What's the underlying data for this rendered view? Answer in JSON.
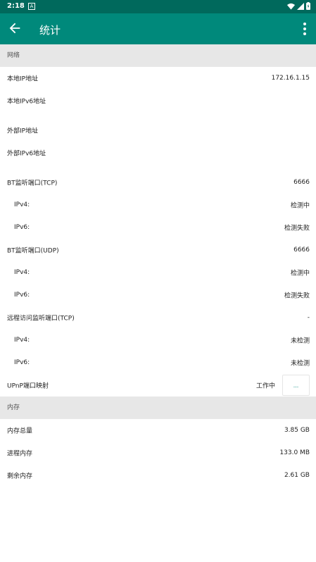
{
  "status_bar": {
    "time": "2:18",
    "notification_letter": "A"
  },
  "app_bar": {
    "title": "统计"
  },
  "network": {
    "header": "网络",
    "local_ipv4": {
      "label": "本地IP地址",
      "value": "172.16.1.15"
    },
    "local_ipv6": {
      "label": "本地IPv6地址",
      "value": ""
    },
    "external_ipv4": {
      "label": "外部IP地址",
      "value": ""
    },
    "external_ipv6": {
      "label": "外部IPv6地址",
      "value": ""
    },
    "bt_tcp": {
      "label": "BT监听端口(TCP)",
      "value": "6666",
      "ipv4": {
        "label": "IPv4:",
        "value": "检测中"
      },
      "ipv6": {
        "label": "IPv6:",
        "value": "检测失败"
      }
    },
    "bt_udp": {
      "label": "BT监听端口(UDP)",
      "value": "6666",
      "ipv4": {
        "label": "IPv4:",
        "value": "检测中"
      },
      "ipv6": {
        "label": "IPv6:",
        "value": "检测失败"
      }
    },
    "remote_tcp": {
      "label": "远程访问监听端口(TCP)",
      "value": "-",
      "ipv4": {
        "label": "IPv4:",
        "value": "未检测"
      },
      "ipv6": {
        "label": "IPv6:",
        "value": "未检测"
      }
    },
    "upnp": {
      "label": "UPnP端口映射",
      "status": "工作中",
      "button_label": "..."
    }
  },
  "memory": {
    "header": "内存",
    "total": {
      "label": "内存总量",
      "value": "3.85 GB"
    },
    "process": {
      "label": "进程内存",
      "value": "133.0 MB"
    },
    "free": {
      "label": "剩余内存",
      "value": "2.61 GB"
    }
  },
  "colors": {
    "status_bar": "#00695c",
    "app_bar": "#00897b",
    "section_header": "#e7e7e7"
  },
  "icons": {
    "back": "arrow-left-icon",
    "more": "more-vert-icon",
    "wifi": "wifi-icon",
    "signal": "signal-icon",
    "battery": "battery-icon"
  }
}
